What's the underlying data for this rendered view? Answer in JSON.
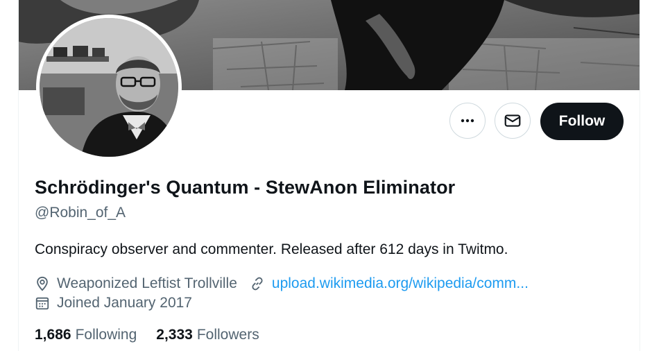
{
  "profile": {
    "display_name": "Schrödinger's Quantum - StewAnon Eliminator",
    "handle": "@Robin_of_A",
    "bio": "Conspiracy observer and commenter. Released after 612 days in Twitmo.",
    "location": "Weaponized Leftist Trollville",
    "website": "upload.wikimedia.org/wikipedia/comm...",
    "joined": "Joined January 2017"
  },
  "actions": {
    "follow_label": "Follow",
    "more_icon": "more-icon",
    "message_icon": "envelope-icon"
  },
  "stats": {
    "following_count": "1,686",
    "following_label": "Following",
    "followers_count": "2,333",
    "followers_label": "Followers"
  },
  "colors": {
    "text_primary": "#0f1419",
    "text_secondary": "#536471",
    "link": "#1d9bf0",
    "follow_bg": "#0f1419",
    "border": "#cfd9de"
  }
}
